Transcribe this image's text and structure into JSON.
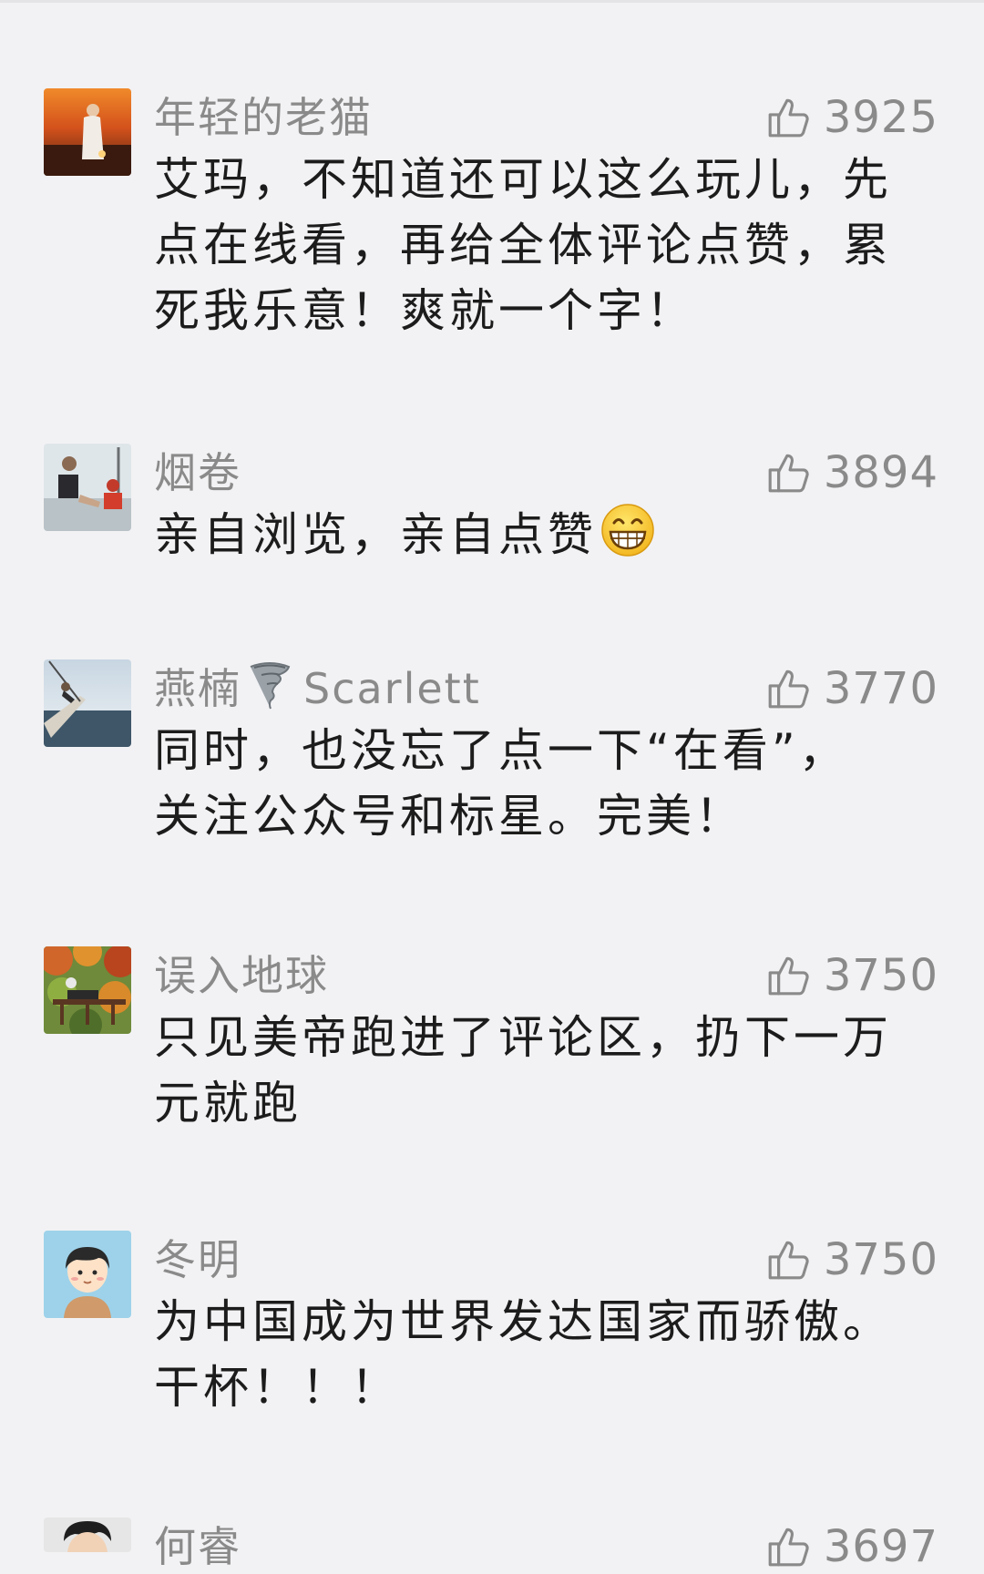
{
  "comments": [
    {
      "nickname": "年轻的老猫",
      "likes": "3925",
      "content": "艾玛，不知道还可以这么玩儿，先\n点在线看，再给全体评论点赞，累\n死我乐意！爽就一个字！"
    },
    {
      "nickname": "烟卷",
      "likes": "3894",
      "content": "亲自浏览，亲自点赞",
      "emoji": "grinning-face-emoji"
    },
    {
      "nickname": "燕楠",
      "nickname_emoji": "tornado-emoji",
      "nickname_suffix": "Scarlett",
      "likes": "3770",
      "content": "同时，也没忘了点一下“在看”，\n关注公众号和标星。完美！"
    },
    {
      "nickname": "误入地球",
      "likes": "3750",
      "content": "只见美帝跑进了评论区，扔下一万\n元就跑"
    },
    {
      "nickname": "冬明",
      "likes": "3750",
      "content": "为中国成为世界发达国家而骄傲。\n干杯！！！"
    },
    {
      "nickname": "何睿",
      "likes": "3697",
      "content": ""
    }
  ],
  "icons": {
    "like": "thumbs-up-icon"
  },
  "colors": {
    "background": "#f2f2f4",
    "meta_text": "#8a8a8a",
    "content_text": "#1c1c1c"
  }
}
